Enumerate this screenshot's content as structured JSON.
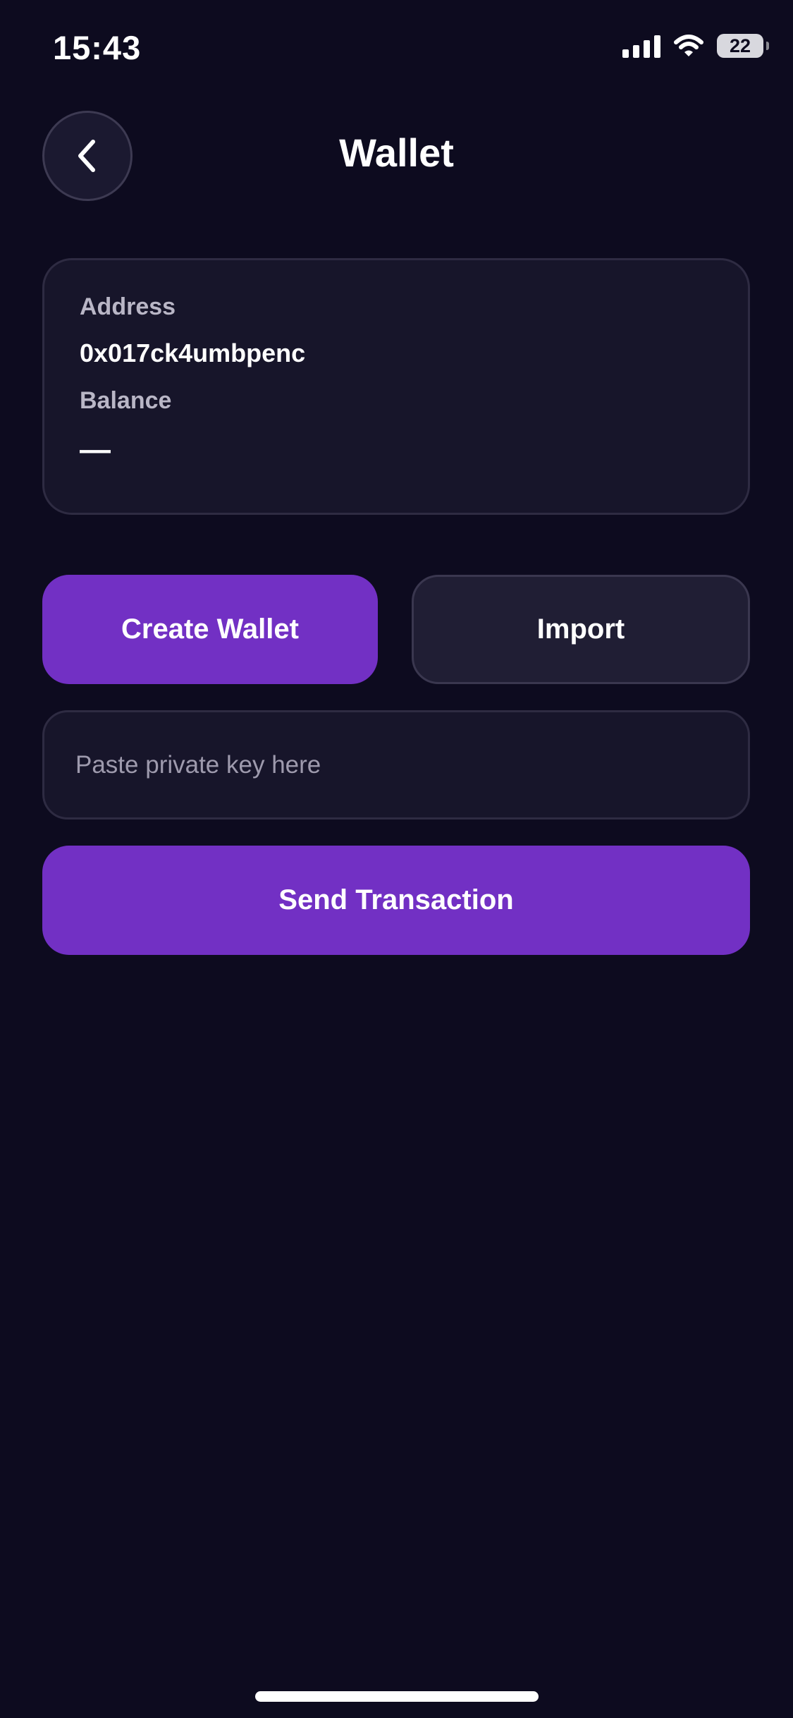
{
  "status_bar": {
    "time": "15:43",
    "battery_level": "22",
    "icons": [
      "signal-icon",
      "wifi-icon",
      "battery-icon"
    ]
  },
  "header": {
    "title": "Wallet",
    "back_icon": "chevron-left-icon"
  },
  "wallet_card": {
    "address_label": "Address",
    "address_value": "0x017ck4umbpenc",
    "balance_label": "Balance",
    "balance_value": "—"
  },
  "actions": {
    "create_label": "Create Wallet",
    "import_label": "Import"
  },
  "private_key": {
    "value": "",
    "placeholder": "Paste private key here"
  },
  "send": {
    "label": "Send Transaction"
  },
  "colors": {
    "background": "#0d0b1f",
    "card": "#17152a",
    "accent": "#7230c4",
    "secondary_button": "#201e34",
    "muted_text": "#b9b6c6"
  }
}
